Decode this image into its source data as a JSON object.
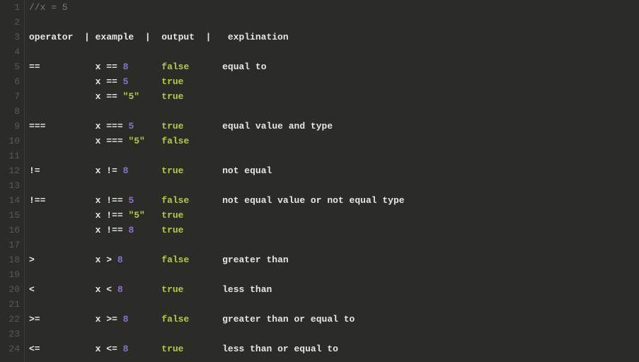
{
  "editor": {
    "colors": {
      "comment": "#7a7a75",
      "default": "#e6e6e6",
      "number": "#8f6fd6",
      "string": "#b6c94a",
      "boolean": "#b6c94a"
    },
    "lineNumbers": [
      "1",
      "2",
      "3",
      "4",
      "5",
      "6",
      "7",
      "8",
      "9",
      "10",
      "11",
      "12",
      "13",
      "14",
      "15",
      "16",
      "17",
      "18",
      "19",
      "20",
      "21",
      "22",
      "23",
      "24"
    ],
    "lines": [
      {
        "num": 1,
        "tokens": [
          {
            "cls": "c-comment",
            "text": "//x = 5"
          }
        ]
      },
      {
        "num": 2,
        "tokens": []
      },
      {
        "num": 3,
        "tokens": [
          {
            "cls": "c-default",
            "text": "operator  | example  |  output  |   explination"
          }
        ]
      },
      {
        "num": 4,
        "tokens": []
      },
      {
        "num": 5,
        "tokens": [
          {
            "cls": "c-op",
            "text": "==          "
          },
          {
            "cls": "c-var",
            "text": "x "
          },
          {
            "cls": "c-op",
            "text": "== "
          },
          {
            "cls": "c-num",
            "text": "8"
          },
          {
            "cls": "c-default",
            "text": "      "
          },
          {
            "cls": "c-bool",
            "text": "false"
          },
          {
            "cls": "c-default",
            "text": "      equal to"
          }
        ]
      },
      {
        "num": 6,
        "tokens": [
          {
            "cls": "c-default",
            "text": "            "
          },
          {
            "cls": "c-var",
            "text": "x "
          },
          {
            "cls": "c-op",
            "text": "== "
          },
          {
            "cls": "c-num",
            "text": "5"
          },
          {
            "cls": "c-default",
            "text": "      "
          },
          {
            "cls": "c-bool",
            "text": "true"
          }
        ]
      },
      {
        "num": 7,
        "tokens": [
          {
            "cls": "c-default",
            "text": "            "
          },
          {
            "cls": "c-var",
            "text": "x "
          },
          {
            "cls": "c-op",
            "text": "== "
          },
          {
            "cls": "c-str",
            "text": "\"5\""
          },
          {
            "cls": "c-default",
            "text": "    "
          },
          {
            "cls": "c-bool",
            "text": "true"
          }
        ]
      },
      {
        "num": 8,
        "tokens": []
      },
      {
        "num": 9,
        "tokens": [
          {
            "cls": "c-op",
            "text": "===         "
          },
          {
            "cls": "c-var",
            "text": "x "
          },
          {
            "cls": "c-op",
            "text": "=== "
          },
          {
            "cls": "c-num",
            "text": "5"
          },
          {
            "cls": "c-default",
            "text": "     "
          },
          {
            "cls": "c-bool",
            "text": "true"
          },
          {
            "cls": "c-default",
            "text": "       equal value and type"
          }
        ]
      },
      {
        "num": 10,
        "tokens": [
          {
            "cls": "c-default",
            "text": "            "
          },
          {
            "cls": "c-var",
            "text": "x "
          },
          {
            "cls": "c-op",
            "text": "=== "
          },
          {
            "cls": "c-str",
            "text": "\"5\""
          },
          {
            "cls": "c-default",
            "text": "   "
          },
          {
            "cls": "c-bool",
            "text": "false"
          }
        ]
      },
      {
        "num": 11,
        "tokens": []
      },
      {
        "num": 12,
        "tokens": [
          {
            "cls": "c-op",
            "text": "!=          "
          },
          {
            "cls": "c-var",
            "text": "x "
          },
          {
            "cls": "c-op",
            "text": "!= "
          },
          {
            "cls": "c-num",
            "text": "8"
          },
          {
            "cls": "c-default",
            "text": "      "
          },
          {
            "cls": "c-bool",
            "text": "true"
          },
          {
            "cls": "c-default",
            "text": "       not equal"
          }
        ]
      },
      {
        "num": 13,
        "tokens": []
      },
      {
        "num": 14,
        "tokens": [
          {
            "cls": "c-op",
            "text": "!==         "
          },
          {
            "cls": "c-var",
            "text": "x "
          },
          {
            "cls": "c-op",
            "text": "!== "
          },
          {
            "cls": "c-num",
            "text": "5"
          },
          {
            "cls": "c-default",
            "text": "     "
          },
          {
            "cls": "c-bool",
            "text": "false"
          },
          {
            "cls": "c-default",
            "text": "      not equal value or not equal type"
          }
        ]
      },
      {
        "num": 15,
        "tokens": [
          {
            "cls": "c-default",
            "text": "            "
          },
          {
            "cls": "c-var",
            "text": "x "
          },
          {
            "cls": "c-op",
            "text": "!== "
          },
          {
            "cls": "c-str",
            "text": "\"5\""
          },
          {
            "cls": "c-default",
            "text": "   "
          },
          {
            "cls": "c-bool",
            "text": "true"
          }
        ]
      },
      {
        "num": 16,
        "tokens": [
          {
            "cls": "c-default",
            "text": "            "
          },
          {
            "cls": "c-var",
            "text": "x "
          },
          {
            "cls": "c-op",
            "text": "!== "
          },
          {
            "cls": "c-num",
            "text": "8"
          },
          {
            "cls": "c-default",
            "text": "     "
          },
          {
            "cls": "c-bool",
            "text": "true"
          }
        ]
      },
      {
        "num": 17,
        "tokens": []
      },
      {
        "num": 18,
        "tokens": [
          {
            "cls": "c-op",
            "text": ">           "
          },
          {
            "cls": "c-var",
            "text": "x "
          },
          {
            "cls": "c-op",
            "text": "> "
          },
          {
            "cls": "c-num",
            "text": "8"
          },
          {
            "cls": "c-default",
            "text": "       "
          },
          {
            "cls": "c-bool",
            "text": "false"
          },
          {
            "cls": "c-default",
            "text": "      greater than"
          }
        ]
      },
      {
        "num": 19,
        "tokens": []
      },
      {
        "num": 20,
        "tokens": [
          {
            "cls": "c-op",
            "text": "<           "
          },
          {
            "cls": "c-var",
            "text": "x "
          },
          {
            "cls": "c-op",
            "text": "< "
          },
          {
            "cls": "c-num",
            "text": "8"
          },
          {
            "cls": "c-default",
            "text": "       "
          },
          {
            "cls": "c-bool",
            "text": "true"
          },
          {
            "cls": "c-default",
            "text": "       less than"
          }
        ]
      },
      {
        "num": 21,
        "tokens": []
      },
      {
        "num": 22,
        "tokens": [
          {
            "cls": "c-op",
            "text": ">=          "
          },
          {
            "cls": "c-var",
            "text": "x "
          },
          {
            "cls": "c-op",
            "text": ">= "
          },
          {
            "cls": "c-num",
            "text": "8"
          },
          {
            "cls": "c-default",
            "text": "      "
          },
          {
            "cls": "c-bool",
            "text": "false"
          },
          {
            "cls": "c-default",
            "text": "      greater than or equal to"
          }
        ]
      },
      {
        "num": 23,
        "tokens": []
      },
      {
        "num": 24,
        "tokens": [
          {
            "cls": "c-op",
            "text": "<=          "
          },
          {
            "cls": "c-var",
            "text": "x "
          },
          {
            "cls": "c-op",
            "text": "<= "
          },
          {
            "cls": "c-num",
            "text": "8"
          },
          {
            "cls": "c-default",
            "text": "      "
          },
          {
            "cls": "c-bool",
            "text": "true"
          },
          {
            "cls": "c-default",
            "text": "       less than or equal to"
          }
        ]
      }
    ]
  }
}
